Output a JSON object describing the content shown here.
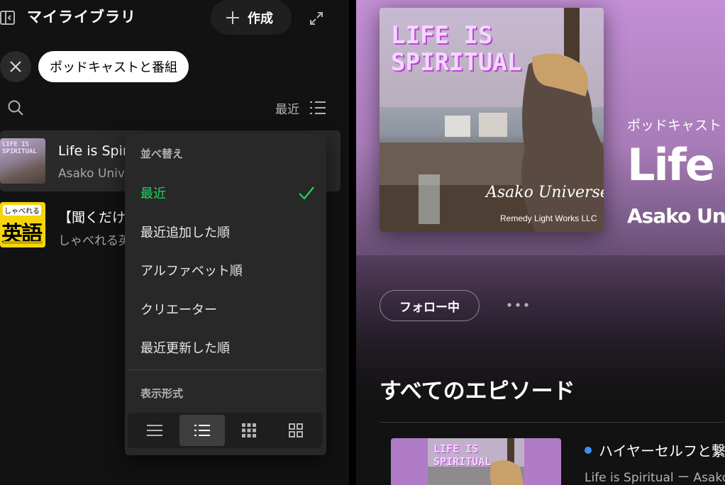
{
  "sidebar": {
    "title": "マイライブラリ",
    "create_label": "作成",
    "filter_chip": "ポッドキャストと番組",
    "sort_label": "最近",
    "items": [
      {
        "title": "Life is Spiritual",
        "subtitle": "Asako Universe"
      },
      {
        "title": "【聞くだけ】しゃべれる英語",
        "subtitle": "しゃべれる英語"
      }
    ],
    "thumb_english": {
      "tag": "しゃべれる",
      "big": "英語"
    },
    "thumb_life_text": "LIFE IS SPIRITUAL"
  },
  "sort_menu": {
    "heading": "並べ替え",
    "options": [
      "最近",
      "最近追加した順",
      "アルファベット順",
      "クリエーター",
      "最近更新した順"
    ],
    "selected_index": 0,
    "view_heading": "表示形式",
    "view_options": [
      "compact-icon",
      "list-icon",
      "grid-icon",
      "large-grid-icon"
    ],
    "view_selected_index": 1
  },
  "main": {
    "type_label": "ポッドキャスト",
    "title": "Life is Spiritual",
    "author": "Asako Universe",
    "cover_title_line1": "LIFE IS",
    "cover_title_line2": "SPIRITUAL",
    "cover_signature": "Asako Universe",
    "cover_credit": "Remedy Light Works LLC",
    "follow_label": "フォロー中",
    "episodes_heading": "すべてのエピソード",
    "episode": {
      "title": "ハイヤーセルフと繋がる",
      "subtitle": "Life is Spiritual ー Asako Universe",
      "thumb_line1": "LIFE IS",
      "thumb_line2": "SPIRITUAL"
    }
  },
  "colors": {
    "accent_green": "#1ed760",
    "hero_purple": "#c38fd6",
    "new_dot_blue": "#3d91f4"
  }
}
